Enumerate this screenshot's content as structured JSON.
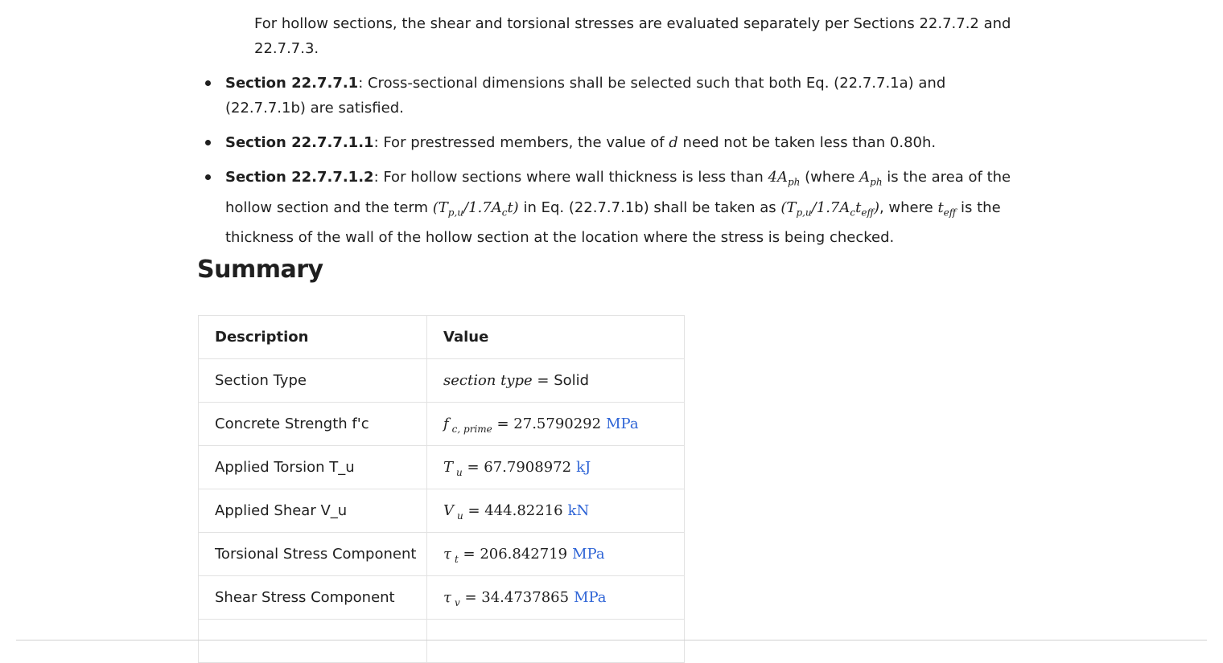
{
  "intro": {
    "text": "For hollow sections, the shear and torsional stresses are evaluated separately per Sections 22.7.7.2 and 22.7.7.3."
  },
  "bullets": [
    {
      "title": "Section 22.7.7.1",
      "text": ": Cross-sectional dimensions shall be selected such that both Eq. (22.7.7.1a) and (22.7.7.1b) are satisfied."
    },
    {
      "title": "Section 22.7.7.1.1",
      "text_before": ": For prestressed members, the value of ",
      "math": "d",
      "text_after": " need not be taken less than 0.80h."
    },
    {
      "title": "Section 22.7.7.1.2",
      "t1": ": For hollow sections where wall thickness is less than ",
      "m1": "4A",
      "m1_sub": "ph",
      "t2": " (where ",
      "m2": "A",
      "m2_sub": "ph",
      "t3": " is the area of the hollow section and the term ",
      "m3a": "(T",
      "m3_sub1": "p,u",
      "m3b": "/1.7A",
      "m3_sub2": "c",
      "m3c": "t)",
      "t4": " in Eq. (22.7.7.1b) shall be taken as ",
      "m4a": "(T",
      "m4_sub1": "p,u",
      "m4b": "/1.7A",
      "m4_sub2": "c",
      "m4c": "t",
      "m4_sub3": "eff",
      "m4d": ")",
      "t5": ", where ",
      "m5": "t",
      "m5_sub": "eff",
      "t6": " is the thickness of the wall of the hollow section at the location where the stress is being checked."
    }
  ],
  "summary": {
    "heading": "Summary",
    "headers": [
      "Description",
      "Value"
    ],
    "rows": [
      {
        "desc": "Section Type",
        "sym": "section type",
        "sub": "",
        "eq": " = ",
        "num": "",
        "text_value": "Solid",
        "unit": ""
      },
      {
        "desc": "Concrete Strength f'c",
        "sym": "f",
        "sub": "c, prime",
        "eq": " = ",
        "num": "27.5790292",
        "text_value": "",
        "unit": "MPa"
      },
      {
        "desc": "Applied Torsion T_u",
        "sym": "T",
        "sub": "u",
        "eq": " = ",
        "num": "67.7908972",
        "text_value": "",
        "unit": "kJ"
      },
      {
        "desc": "Applied Shear V_u",
        "sym": "V",
        "sub": "u",
        "eq": " = ",
        "num": "444.82216",
        "text_value": "",
        "unit": "kN"
      },
      {
        "desc": "Torsional Stress Component",
        "sym": "τ",
        "sub": "t",
        "eq": " = ",
        "num": "206.842719",
        "text_value": "",
        "unit": "MPa"
      },
      {
        "desc": "Shear Stress Component",
        "sym": "τ",
        "sub": "v",
        "eq": " = ",
        "num": "34.4737865",
        "text_value": "",
        "unit": "MPa"
      }
    ]
  },
  "colors": {
    "text": "#1f1f1f",
    "unit": "#2e64d6",
    "border": "#e2e2e2"
  }
}
